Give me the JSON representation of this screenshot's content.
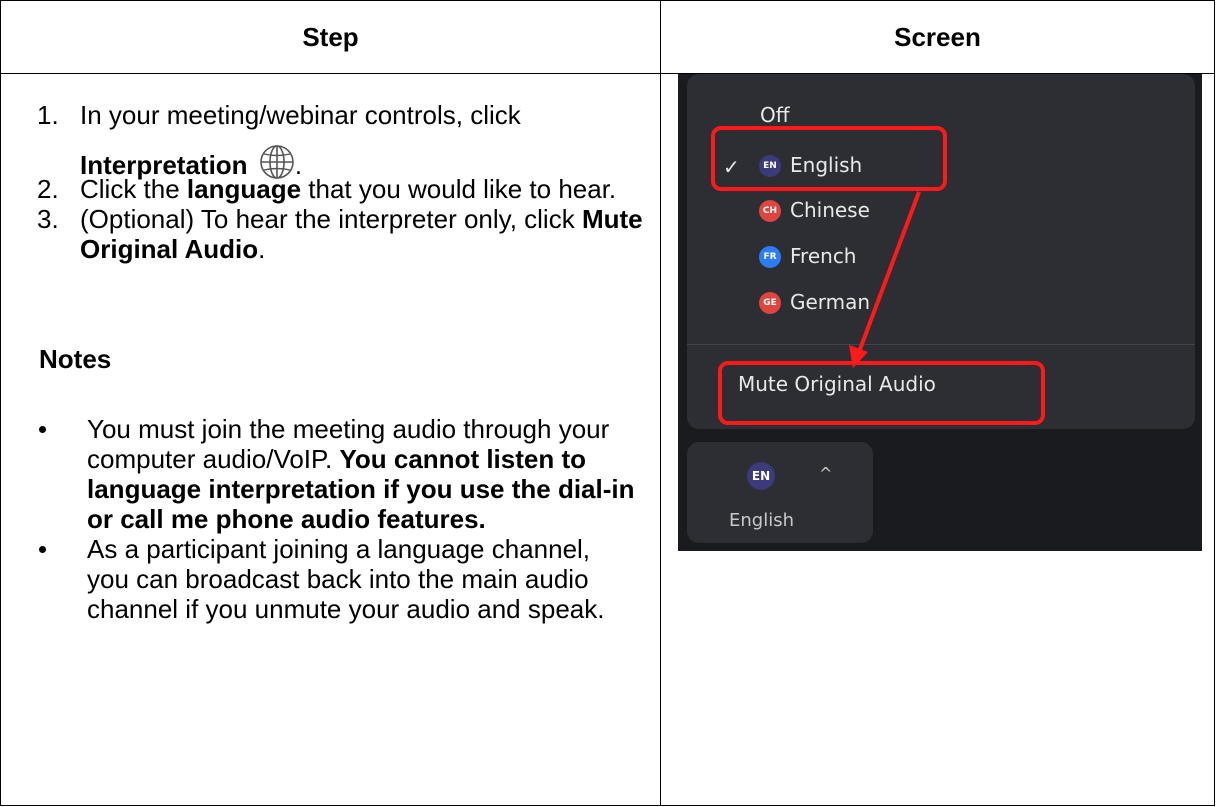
{
  "table": {
    "headers": {
      "step": "Step",
      "screen": "Screen"
    }
  },
  "steps": [
    {
      "num": "1.",
      "text_a": "In your meeting/webinar controls, click",
      "bold": "Interpretation",
      "after": ".",
      "icon": "globe-icon"
    },
    {
      "num": "2.",
      "before": "Click the ",
      "bold": "language",
      "after": " that you would like to hear."
    },
    {
      "num": "3.",
      "before": "(Optional) To hear the interpreter only, click ",
      "bold": "Mute Original Audio",
      "after": "."
    }
  ],
  "notes": {
    "heading": "Notes",
    "items": [
      {
        "text": "You must join the meeting audio through your computer audio/VoIP.",
        "bold": "You cannot listen to language interpretation if you use the dial-in or call me phone audio features."
      },
      {
        "text": "As a participant joining a language channel, you can broadcast back into the main audio channel if you unmute your audio and speak."
      }
    ]
  },
  "screenshot": {
    "menu": {
      "off": "Off",
      "languages": [
        {
          "code": "EN",
          "label": "English",
          "selected": true,
          "color": "#3b3a7a"
        },
        {
          "code": "CH",
          "label": "Chinese",
          "selected": false,
          "color": "#e0443e"
        },
        {
          "code": "FR",
          "label": "French",
          "selected": false,
          "color": "#2d7cf6"
        },
        {
          "code": "GE",
          "label": "German",
          "selected": false,
          "color": "#e0443e"
        }
      ],
      "mute": "Mute Original Audio"
    },
    "button": {
      "code": "EN",
      "label": "English"
    },
    "highlight_color": "#ff1a1a"
  }
}
